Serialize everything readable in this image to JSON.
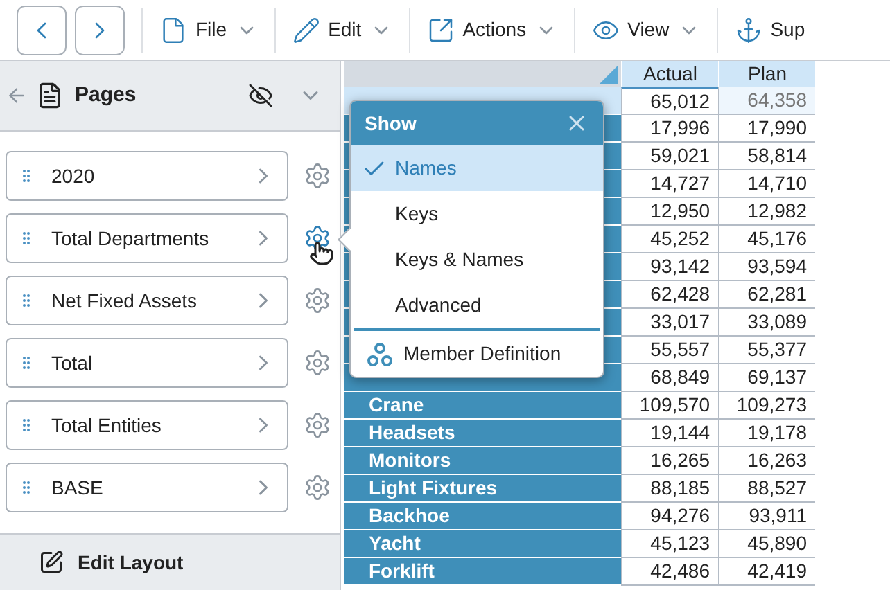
{
  "toolbar": {
    "nav": [
      {
        "kind": "back"
      },
      {
        "kind": "forward"
      }
    ],
    "menus": [
      {
        "label": "File"
      },
      {
        "label": "Edit"
      },
      {
        "label": "Actions"
      },
      {
        "label": "View"
      },
      {
        "label": "Sup"
      }
    ]
  },
  "pages_panel": {
    "title": "Pages",
    "items": [
      {
        "label": "2020",
        "hovered": false
      },
      {
        "label": "Total Departments",
        "hovered": true
      },
      {
        "label": "Net Fixed Assets",
        "hovered": false
      },
      {
        "label": "Total",
        "hovered": false
      },
      {
        "label": "Total Entities",
        "hovered": false
      },
      {
        "label": "BASE",
        "hovered": false
      }
    ],
    "footer": "Edit Layout"
  },
  "grid": {
    "columns": [
      "Actual",
      "Plan"
    ],
    "rows": [
      {
        "values": [
          "65,012",
          "64,358"
        ],
        "selected": true
      },
      {
        "values": [
          "17,996",
          "17,990"
        ],
        "selected": false
      },
      {
        "values": [
          "59,021",
          "58,814"
        ],
        "selected": false
      },
      {
        "values": [
          "14,727",
          "14,710"
        ],
        "selected": false
      },
      {
        "values": [
          "12,950",
          "12,982"
        ],
        "selected": false
      },
      {
        "values": [
          "45,252",
          "45,176"
        ],
        "selected": false
      },
      {
        "values": [
          "93,142",
          "93,594"
        ],
        "selected": false
      },
      {
        "values": [
          "62,428",
          "62,281"
        ],
        "selected": false
      },
      {
        "values": [
          "33,017",
          "33,089"
        ],
        "selected": false
      },
      {
        "values": [
          "55,557",
          "55,377"
        ],
        "selected": false
      },
      {
        "values": [
          "68,849",
          "69,137"
        ],
        "selected": false
      },
      {
        "label": "Crane",
        "values": [
          "109,570",
          "109,273"
        ],
        "selected": false
      },
      {
        "label": "Headsets",
        "values": [
          "19,144",
          "19,178"
        ],
        "selected": false
      },
      {
        "label": "Monitors",
        "values": [
          "16,265",
          "16,263"
        ],
        "selected": false
      },
      {
        "label": "Light Fixtures",
        "values": [
          "88,185",
          "88,527"
        ],
        "selected": false
      },
      {
        "label": "Backhoe",
        "values": [
          "94,276",
          "93,911"
        ],
        "selected": false
      },
      {
        "label": "Yacht",
        "values": [
          "45,123",
          "45,890"
        ],
        "selected": false
      },
      {
        "label": "Forklift",
        "values": [
          "42,486",
          "42,419"
        ],
        "selected": false
      }
    ]
  },
  "popover": {
    "title": "Show",
    "options": [
      {
        "label": "Names",
        "selected": true
      },
      {
        "label": "Keys",
        "selected": false
      },
      {
        "label": "Keys & Names",
        "selected": false
      },
      {
        "label": "Advanced",
        "selected": false
      }
    ],
    "action": "Member Definition"
  }
}
